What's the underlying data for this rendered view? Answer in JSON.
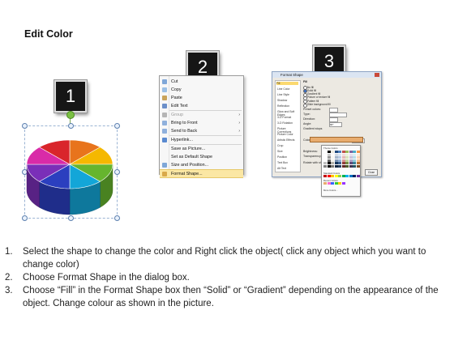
{
  "page": {
    "title": "Edit Color"
  },
  "badges": [
    "1",
    "2",
    "3"
  ],
  "context_menu": {
    "items": [
      {
        "label": "Cut",
        "icon": "scissors-icon",
        "submenu": false
      },
      {
        "label": "Copy",
        "icon": "copy-icon",
        "submenu": false
      },
      {
        "label": "Paste",
        "icon": "paste-icon",
        "submenu": false
      },
      {
        "label": "Edit Text",
        "icon": "edit-text-icon",
        "submenu": false
      },
      {
        "label": "Group",
        "icon": "group-icon",
        "submenu": true
      },
      {
        "label": "Bring to Front",
        "icon": "bring-front-icon",
        "submenu": true
      },
      {
        "label": "Send to Back",
        "icon": "send-back-icon",
        "submenu": true
      },
      {
        "label": "Hyperlink...",
        "icon": "hyperlink-icon",
        "submenu": false
      },
      {
        "label": "Save as Picture...",
        "icon": "",
        "submenu": false
      },
      {
        "label": "Set as Default Shape",
        "icon": "",
        "submenu": false
      },
      {
        "label": "Size and Position...",
        "icon": "size-icon",
        "submenu": false
      },
      {
        "label": "Format Shape...",
        "icon": "format-shape-icon",
        "submenu": false,
        "highlighted": true
      }
    ]
  },
  "dialog": {
    "title": "Format Shape",
    "nav": [
      "Fill",
      "Line Color",
      "Line Style",
      "Shadow",
      "Reflection",
      "Glow and Soft Edges",
      "3-D Format",
      "3-D Rotation",
      "Picture Corrections",
      "Picture Color",
      "Artistic Effects",
      "Crop",
      "Size",
      "Position",
      "Text Box",
      "Alt Text"
    ],
    "section": "Fill",
    "options": [
      "No fill",
      "Solid fill",
      "Gradient fill",
      "Picture or texture fill",
      "Pattern fill",
      "Slide background fill"
    ],
    "labels": [
      "Preset colors:",
      "Type:",
      "Direction:",
      "Angle:",
      "Gradient stops",
      "Color",
      "Position:",
      "Brightness:",
      "Transparency:"
    ],
    "values": {
      "angle": "90°",
      "position": "0%",
      "transparency": "0%"
    },
    "buttons": [
      "Close"
    ],
    "checkbox": "Rotate with shape"
  },
  "palette": {
    "theme_label": "Theme Colors",
    "standard_label": "Standard Colors",
    "recent_label": "Recent Colors",
    "more_label": "More Colors...",
    "theme_colors": [
      "#ffffff",
      "#000000",
      "#eeece1",
      "#1f497d",
      "#4f81bd",
      "#c0504d",
      "#9bbb59",
      "#8064a2",
      "#4bacc6",
      "#f79646"
    ],
    "standard_colors": [
      "#c00000",
      "#ff0000",
      "#ffc000",
      "#ffff00",
      "#92d050",
      "#00b050",
      "#00b0f0",
      "#0070c0",
      "#002060",
      "#7030a0"
    ],
    "recent_colors": [
      "#e8ac6e",
      "#ff66cc",
      "#3366ff",
      "#33cc33",
      "#ffcc00",
      "#9933ff"
    ]
  },
  "instructions": [
    "Select the shape to change the color and Right click the object( click any object which you want to change color)",
    "Choose Format Shape in the dialog box.",
    "Choose “Fill” in the Format Shape box then “Solid” or “Gradient” depending on the appearance of the object. Change colour as shown in the picture."
  ],
  "pie_colors": [
    "#e8741c",
    "#f5b800",
    "#66b52e",
    "#13a6d8",
    "#2b3fbf",
    "#7a2fb8",
    "#d92ba8",
    "#d9252b"
  ]
}
